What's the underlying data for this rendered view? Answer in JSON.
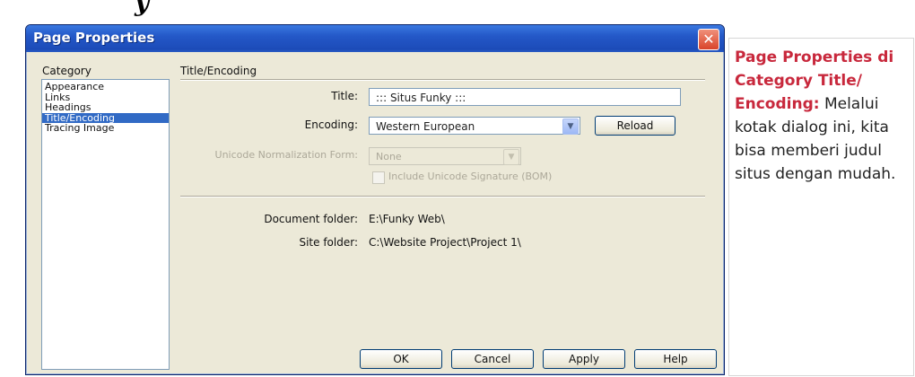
{
  "heading_fragment": "y",
  "dialog": {
    "title": "Page Properties",
    "close_glyph": "✕",
    "category_label": "Category",
    "categories": [
      "Appearance",
      "Links",
      "Headings",
      "Title/Encoding",
      "Tracing Image"
    ],
    "selected_category": "Title/Encoding",
    "section_title": "Title/Encoding",
    "title_label": "Title:",
    "title_value": "::: Situs Funky :::",
    "encoding_label": "Encoding:",
    "encoding_value": "Western European",
    "reload_label": "Reload",
    "unicode_norm_label": "Unicode Normalization Form:",
    "unicode_norm_value": "None",
    "bom_label": "Include Unicode Signature (BOM)",
    "doc_folder_label": "Document folder:",
    "doc_folder_value": "E:\\Funky Web\\",
    "site_folder_label": "Site folder:",
    "site_folder_value": "C:\\Website Project\\Project 1\\",
    "buttons": {
      "ok": "OK",
      "cancel": "Cancel",
      "apply": "Apply",
      "help": "Help"
    }
  },
  "caption": {
    "highlight": "Page Properties di Category Title/ Encoding:",
    "body": " Melalui kotak dialog ini, kita bisa memberi judul situs dengan mudah."
  },
  "colors": {
    "titlebar": "#2458c8",
    "selection": "#316ac5",
    "caption_highlight": "#c8283c",
    "dialog_bg": "#ece9d8"
  }
}
